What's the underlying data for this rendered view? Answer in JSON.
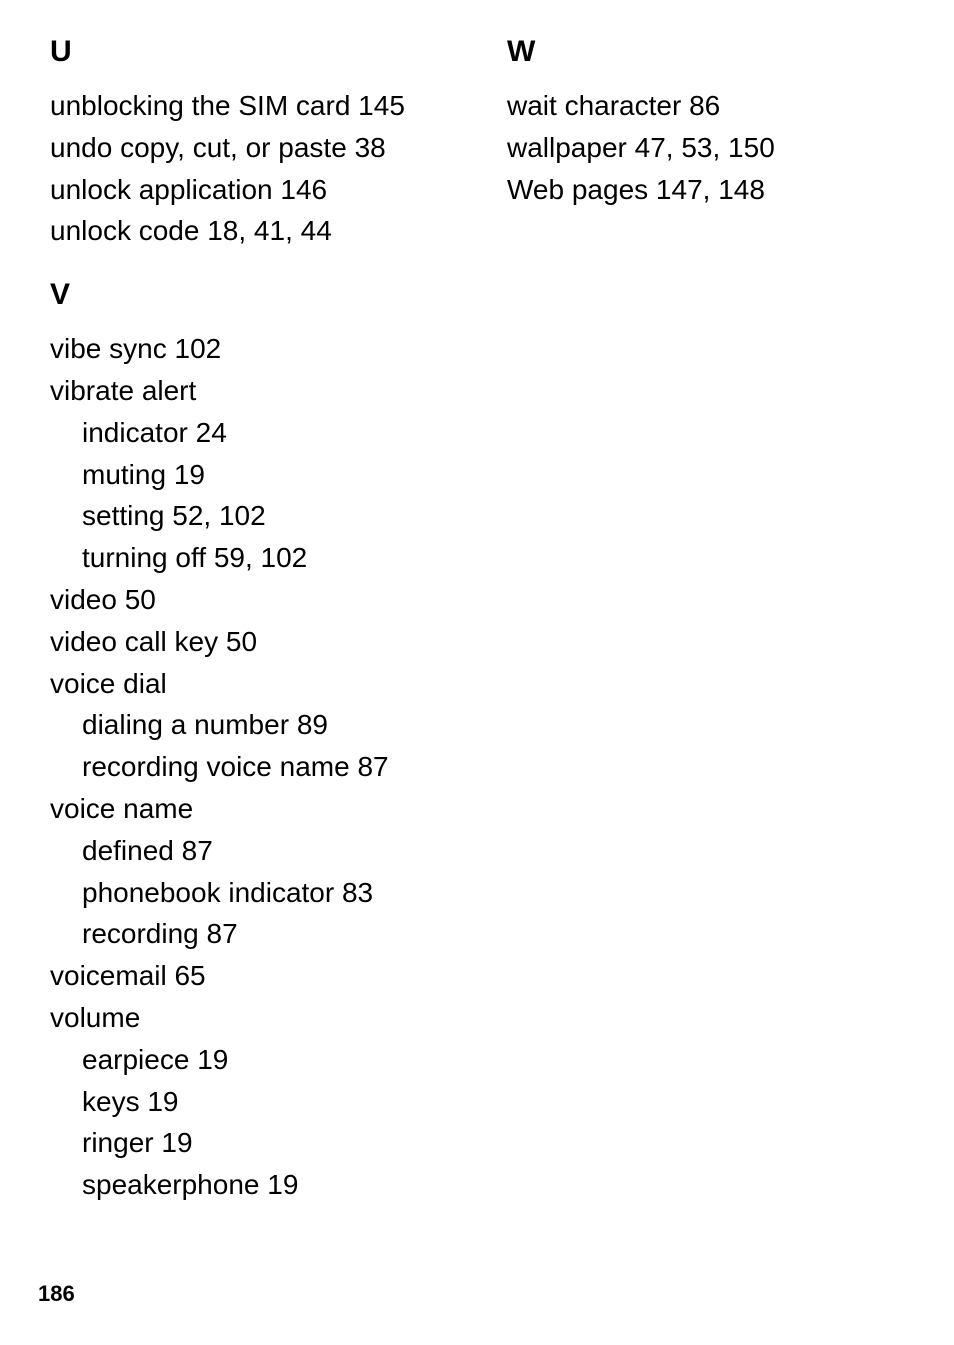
{
  "pageNumber": "186",
  "leftColumn": [
    {
      "type": "head",
      "text": "U"
    },
    {
      "type": "entry",
      "term": "unblocking the SIM card",
      "pages": "145"
    },
    {
      "type": "entry",
      "term": "undo copy, cut, or paste",
      "pages": "38"
    },
    {
      "type": "entry",
      "term": "unlock application",
      "pages": "146"
    },
    {
      "type": "entry",
      "term": "unlock code",
      "pages": "18, 41, 44"
    },
    {
      "type": "head",
      "text": "V",
      "later": true
    },
    {
      "type": "entry",
      "term": "vibe sync",
      "pages": "102"
    },
    {
      "type": "entry",
      "term": "vibrate alert",
      "pages": ""
    },
    {
      "type": "sub",
      "term": "indicator",
      "pages": "24"
    },
    {
      "type": "sub",
      "term": "muting",
      "pages": "19"
    },
    {
      "type": "sub",
      "term": "setting",
      "pages": "52, 102"
    },
    {
      "type": "sub",
      "term": "turning off",
      "pages": "59, 102"
    },
    {
      "type": "entry",
      "term": "video",
      "pages": "50"
    },
    {
      "type": "entry",
      "term": "video call key",
      "pages": "50"
    },
    {
      "type": "entry",
      "term": "voice dial",
      "pages": ""
    },
    {
      "type": "sub",
      "term": "dialing a number",
      "pages": "89"
    },
    {
      "type": "sub",
      "term": "recording voice name",
      "pages": "87"
    },
    {
      "type": "entry",
      "term": "voice name",
      "pages": ""
    },
    {
      "type": "sub",
      "term": "defined",
      "pages": "87"
    },
    {
      "type": "sub",
      "term": "phonebook indicator",
      "pages": "83"
    },
    {
      "type": "sub",
      "term": "recording",
      "pages": "87"
    },
    {
      "type": "entry",
      "term": "voicemail",
      "pages": "65"
    },
    {
      "type": "entry",
      "term": "volume",
      "pages": ""
    },
    {
      "type": "sub",
      "term": "earpiece",
      "pages": "19"
    },
    {
      "type": "sub",
      "term": "keys",
      "pages": "19"
    },
    {
      "type": "sub",
      "term": "ringer",
      "pages": "19"
    },
    {
      "type": "sub",
      "term": "speakerphone",
      "pages": "19"
    }
  ],
  "rightColumn": [
    {
      "type": "head",
      "text": "W"
    },
    {
      "type": "entry",
      "term": "wait character",
      "pages": "86"
    },
    {
      "type": "entry",
      "term": "wallpaper",
      "pages": "47, 53, 150"
    },
    {
      "type": "entry",
      "term": "Web pages",
      "pages": "147, 148"
    }
  ]
}
